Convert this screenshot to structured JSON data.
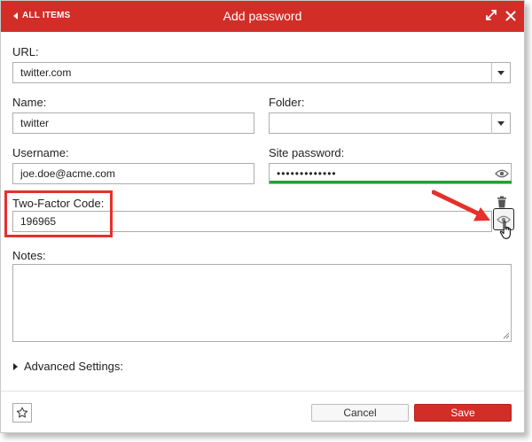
{
  "header": {
    "back_label": "ALL ITEMS",
    "title": "Add password",
    "background_color": "#d32d27"
  },
  "form": {
    "url": {
      "label": "URL:",
      "value": "twitter.com"
    },
    "name": {
      "label": "Name:",
      "value": "twitter"
    },
    "folder": {
      "label": "Folder:",
      "value": ""
    },
    "username": {
      "label": "Username:",
      "value": "joe.doe@acme.com"
    },
    "site_password": {
      "label": "Site password:",
      "value": "•••••••••••••",
      "strength_color": "#1fa432"
    },
    "two_factor": {
      "label": "Two-Factor Code:",
      "value": "196965"
    },
    "notes": {
      "label": "Notes:",
      "value": ""
    },
    "advanced_label": "Advanced Settings:"
  },
  "footer": {
    "cancel_label": "Cancel",
    "save_label": "Save"
  },
  "annotations": {
    "highlight_color": "#e5302c"
  },
  "icons": {
    "back": "caret-left-icon",
    "expand": "expand-icon",
    "close": "close-icon",
    "dropdown": "caret-down-icon",
    "show_password": "eye-icon",
    "delete": "trash-icon",
    "cursor": "hand-pointer-icon",
    "favorite": "star-icon",
    "advanced": "caret-right-icon"
  }
}
